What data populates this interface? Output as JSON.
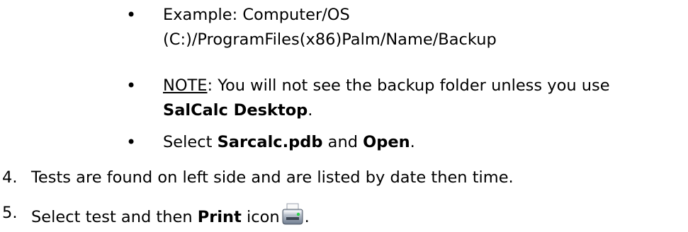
{
  "bullets": {
    "symbol": "•",
    "b1": {
      "line1": "Example: Computer/OS",
      "line2": "(C:)/ProgramFiles(x86)Palm/Name/Backup"
    },
    "b2": {
      "note": "NOTE",
      "text1": ": You will not see the backup folder unless you use",
      "bold": "SalCalc Desktop",
      "end": "."
    },
    "b3": {
      "pre": "Select ",
      "bold1": "Sarcalc.pdb",
      "mid": " and ",
      "bold2": "Open",
      "end": "."
    }
  },
  "steps": {
    "s4": {
      "num": "4.",
      "text": "Tests are found on left side and are listed by date then time."
    },
    "s5": {
      "num": "5.",
      "pre": "Select test and then ",
      "bold": "Print",
      "post": " icon",
      "end": ".",
      "icon": "printer-icon"
    }
  }
}
